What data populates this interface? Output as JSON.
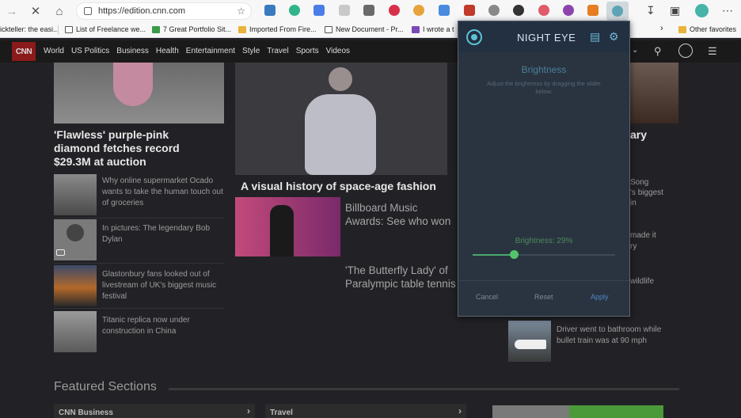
{
  "browser": {
    "url": "https://edition.cnn.com",
    "bookmarks": [
      "ickteller: the easi...",
      "List of Freelance we...",
      "7 Great Portfolio Sit...",
      "Imported From Fire...",
      "New Document - Pr...",
      "I wrote a t",
      "Other favorites"
    ]
  },
  "cnn": {
    "logo": "CNN",
    "nav": [
      "World",
      "US Politics",
      "Business",
      "Health",
      "Entertainment",
      "Style",
      "Travel",
      "Sports",
      "Videos"
    ]
  },
  "stories": {
    "lead_left": "'Flawless' purple-pink diamond fetches record $29.3M at auction",
    "lead_center": "A visual history of space-age fashion",
    "left_list": [
      "Why online supermarket Ocado wants to take the human touch out of groceries",
      "In pictures: The legendary Bob Dylan",
      "Glastonbury fans looked out of livestream of UK's biggest music festival",
      "Titanic replica now under construction in China"
    ],
    "center_list": [
      "Billboard Music Awards: See who won",
      "'The Butterfly Lady' of Paralympic table tennis"
    ],
    "right_partial": [
      "ary",
      "Song",
      "'s biggest",
      "in",
      "made it",
      "ry",
      "wildlife"
    ],
    "right_bottom": "Driver went to bathroom while bullet train was at 90 mph",
    "featured": "Featured Sections",
    "sections": [
      "CNN Business",
      "Travel"
    ]
  },
  "night_eye": {
    "title": "NIGHT EYE",
    "section_title": "Brightness",
    "description": "Adjust the brightness by dragging the slider below.",
    "brightness_label": "Brightness: 29%",
    "brightness_value": 29,
    "buttons": {
      "cancel": "Cancel",
      "reset": "Reset",
      "apply": "Apply"
    },
    "accent": "#52c46c"
  }
}
